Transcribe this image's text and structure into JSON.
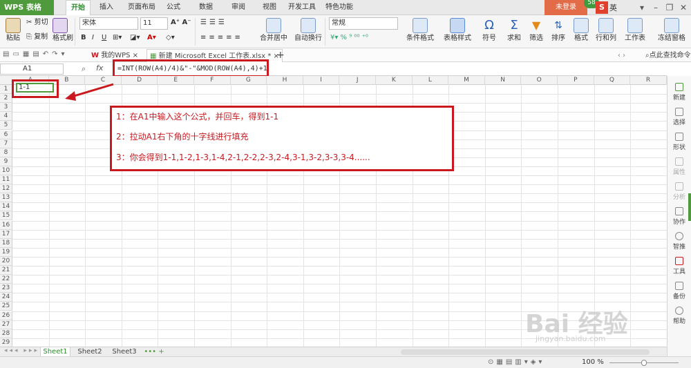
{
  "titlebar": {
    "app_name": "WPS 表格",
    "tabs": [
      "开始",
      "插入",
      "页面布局",
      "公式",
      "数据",
      "审阅",
      "视图",
      "开发工具",
      "特色功能"
    ],
    "login_label": "未登录",
    "badge_count": "58"
  },
  "ribbon": {
    "paste_label": "粘贴",
    "cut_label": "剪切",
    "copy_label": "复制",
    "format_brush_label": "格式刷",
    "font_name": "宋体",
    "font_size": "11",
    "merge_label": "合并居中",
    "wrap_label": "自动换行",
    "number_format": "常规",
    "cond_format_label": "条件格式",
    "table_style_label": "表格样式",
    "symbol_label": "符号",
    "sum_label": "求和",
    "filter_label": "筛选",
    "sort_label": "排序",
    "format_label": "格式",
    "rowcol_label": "行和列",
    "sheet_label": "工作表",
    "freeze_label": "冻结窗格"
  },
  "quickbar": {
    "tab_mywps": "我的WPS",
    "tab_workbook": "新建 Microsoft Excel 工作表.xlsx *",
    "find_label": "点此查找命令"
  },
  "formula": {
    "cell_ref": "A1",
    "fx": "fx",
    "text": "=INT(ROW(A4)/4)&\"-\"&MOD(ROW(A4),4)+1"
  },
  "grid": {
    "columns": [
      "A",
      "B",
      "C",
      "D",
      "E",
      "F",
      "G",
      "H",
      "I",
      "J",
      "K",
      "L",
      "M",
      "N",
      "O",
      "P",
      "Q",
      "R"
    ],
    "rows": [
      "1",
      "2",
      "3",
      "4",
      "5",
      "6",
      "7",
      "8",
      "9",
      "10",
      "11",
      "12",
      "13",
      "14",
      "15",
      "16",
      "17",
      "18",
      "19",
      "20",
      "21",
      "22",
      "23",
      "24",
      "25",
      "26",
      "27",
      "28",
      "29"
    ],
    "a1_value": "1-1"
  },
  "notes": [
    "1：在A1中输入这个公式，并回车，得到1-1",
    "2：拉动A1右下角的十字线进行填充",
    "3：你会得到1-1,1-2,1-3,1-4,2-1,2-2,2-3,2-4,3-1,3-2,3-3,3-4......"
  ],
  "sheets": [
    "Sheet1",
    "Sheet2",
    "Sheet3"
  ],
  "status": {
    "zoom": "100 %"
  },
  "right_panel": [
    "新建",
    "选择",
    "形状",
    "属性",
    "分析",
    "协作",
    "智推",
    "工具",
    "备份",
    "帮助"
  ],
  "watermark": {
    "brand": "Bai 经验",
    "url": "jingyan.baidu.com"
  },
  "colors": {
    "accent": "#4e9a3c",
    "highlight": "#c9191f",
    "login": "#e26b48"
  }
}
